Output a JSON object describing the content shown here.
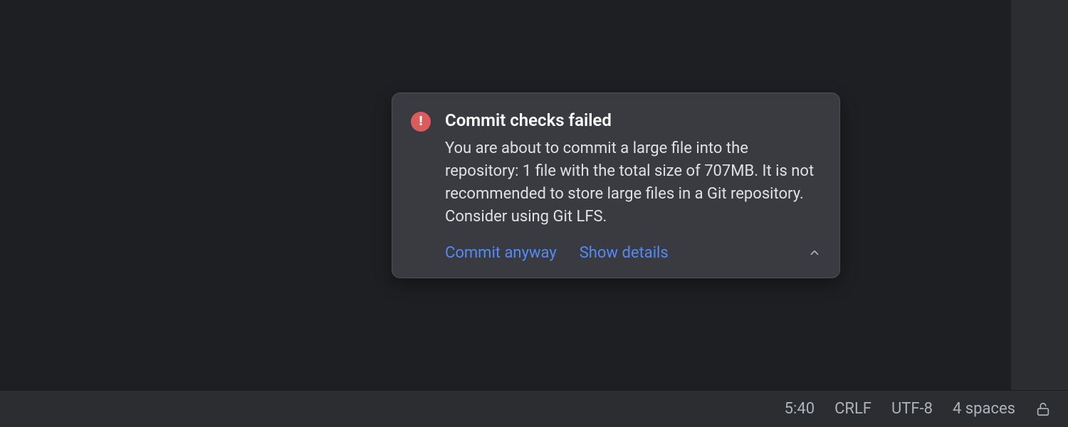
{
  "notification": {
    "title": "Commit checks failed",
    "message": "You are about to commit a large file into the repository: 1 file with the total size of 707MB. It is not recommended to store large files in a Git repository. Consider using Git LFS.",
    "actions": {
      "commit_anyway": "Commit anyway",
      "show_details": "Show details"
    },
    "icon_glyph": "!"
  },
  "statusbar": {
    "position": "5:40",
    "line_ending": "CRLF",
    "encoding": "UTF-8",
    "indent": "4 spaces"
  }
}
